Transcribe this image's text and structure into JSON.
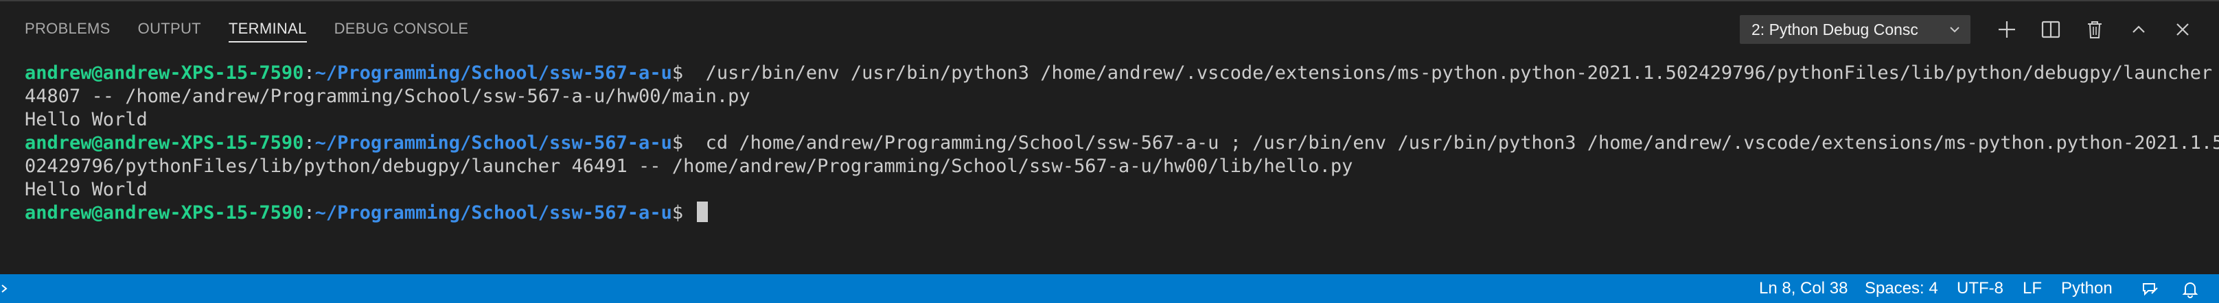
{
  "panel": {
    "tabs": [
      {
        "label": "PROBLEMS",
        "active": false
      },
      {
        "label": "OUTPUT",
        "active": false
      },
      {
        "label": "TERMINAL",
        "active": true
      },
      {
        "label": "DEBUG CONSOLE",
        "active": false
      }
    ],
    "terminal_select": {
      "value": "2: Python Debug Consc"
    },
    "actions": [
      "plus-icon",
      "split-icon",
      "trash-icon",
      "chevron-up-icon",
      "close-icon"
    ]
  },
  "terminal": {
    "lines": [
      {
        "user": "andrew@andrew-XPS-15-7590",
        "sep": ":",
        "path": "~/Programming/School/ssw-567-a-u",
        "prompt": "$",
        "command": "  /usr/bin/env /usr/bin/python3 /home/andrew/.vscode/extensions/ms-python.python-2021.1.502429796/pythonFiles/lib/python/debugpy/launcher"
      },
      {
        "text": "44807 -- /home/andrew/Programming/School/ssw-567-a-u/hw00/main.py"
      },
      {
        "text": "Hello World"
      },
      {
        "user": "andrew@andrew-XPS-15-7590",
        "sep": ":",
        "path": "~/Programming/School/ssw-567-a-u",
        "prompt": "$",
        "command": "  cd /home/andrew/Programming/School/ssw-567-a-u ; /usr/bin/env /usr/bin/python3 /home/andrew/.vscode/extensions/ms-python.python-2021.1.5"
      },
      {
        "text": "02429796/pythonFiles/lib/python/debugpy/launcher 46491 -- /home/andrew/Programming/School/ssw-567-a-u/hw00/lib/hello.py"
      },
      {
        "text": "Hello World"
      },
      {
        "user": "andrew@andrew-XPS-15-7590",
        "sep": ":",
        "path": "~/Programming/School/ssw-567-a-u",
        "prompt": "$",
        "command": " "
      }
    ]
  },
  "statusbar": {
    "position": "Ln 8, Col 38",
    "spaces": "Spaces: 4",
    "encoding": "UTF-8",
    "eol": "LF",
    "language": "Python",
    "icons": [
      "remote-icon",
      "feedback-icon",
      "bell-icon"
    ]
  },
  "colors": {
    "background": "#1e1e1e",
    "statusbar": "#007acc",
    "prompt_user": "#23d18b",
    "prompt_path": "#3b8eea",
    "text": "#cccccc"
  }
}
